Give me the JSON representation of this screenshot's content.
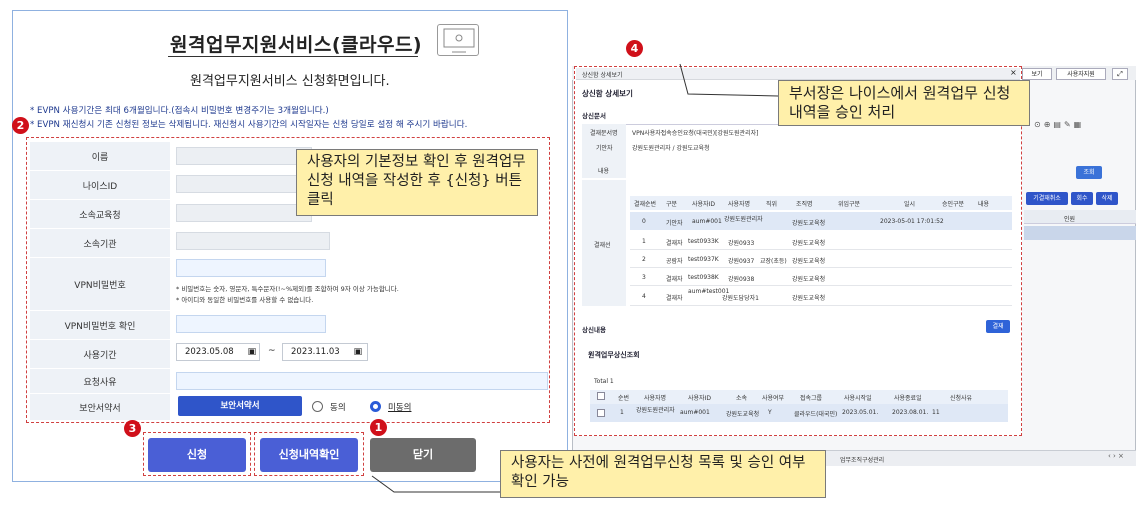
{
  "form": {
    "title": "원격업무지원서비스(클라우드)",
    "subtitle": "원격업무지원서비스 신청화면입니다.",
    "notice1": "* EVPN 사용기간은 최대 6개월입니다.(접속시 비밀번호 변경주기는 3개월입니다.)",
    "notice2": "* EVPN 재신청시 기존 신청된 정보는 삭제됩니다. 재신청시 사용기간의 시작일자는 신청 당일로 설정 해 주시기 바랍니다.",
    "fields": {
      "name_label": "이름",
      "nice_id_label": "나이스ID",
      "office_label": "소속교육청",
      "org_label": "소속기관",
      "vpn_pw_label": "VPN비밀번호",
      "vpn_pw_note1": "* 비밀번호는 숫자, 영문자, 특수문자(!~%제외)를 조합하여 9자 이상 가능합니다.",
      "vpn_pw_note2": "* 아이디와 동일한 비밀번호를 사용할 수 없습니다.",
      "vpn_pw_confirm_label": "VPN비밀번호 확인",
      "period_label": "사용기간",
      "start_date": "2023.05.08",
      "end_date": "2023.11.03",
      "period_sep": "~",
      "reason_label": "요청사유",
      "security_label": "보안서약서",
      "security_button": "보안서약서",
      "agree_label": "동의",
      "disagree_label": "미동의"
    },
    "buttons": {
      "apply": "신청",
      "history": "신청내역확인",
      "close": "닫기"
    }
  },
  "markers": {
    "m1": "1",
    "m2": "2",
    "m3": "3",
    "m4": "4"
  },
  "callouts": {
    "user_info": "사용자의 기본정보 확인 후 원격업무 신청 내역을 작성한 후 {신청} 버튼 클릭",
    "manager": "부서장은 나이스에서 원격업무 신청 내역을 승인 처리",
    "history": "사용자는 사전에 원격업무신청 목록 및 승인 여부 확인 가능"
  },
  "approval": {
    "window_title": "상신함 상세보기",
    "section_title": "상신함 상세보기",
    "doc_section": "상신문서",
    "doc_title_label": "결재문서명",
    "doc_title_value": "VPN사용자접속승인요청(대국민)[강원도원관리자]",
    "drafter_label": "기안자",
    "drafter_value": "강원도원관리자 / 강원도교육청",
    "content_label": "내용",
    "line_label": "결재선",
    "table_headers": [
      "결재순번",
      "구분",
      "사용자ID",
      "사용자명",
      "직위",
      "조직명",
      "위임구분",
      "일시",
      "승인구분",
      "내용"
    ],
    "table_rows": [
      [
        "0",
        "기안자",
        "aum#001",
        "강원도원관리자",
        "",
        "강원도교육청",
        "",
        "2023-05-01 17:01:52",
        "",
        ""
      ],
      [
        "1",
        "결재자",
        "test0933K",
        "강원0933",
        "",
        "강원도교육청",
        "",
        "",
        "",
        ""
      ],
      [
        "2",
        "공람자",
        "test0937K",
        "강원0937",
        "교장(초등)",
        "강원도교육청",
        "",
        "",
        "",
        ""
      ],
      [
        "3",
        "결재자",
        "test0938K",
        "강원0938",
        "",
        "강원도교육청",
        "",
        "",
        "",
        ""
      ],
      [
        "4",
        "결재자",
        "aum#test001",
        "강원도담당자1",
        "",
        "강원도교육청",
        "",
        "",
        "",
        ""
      ]
    ],
    "submit_section": "상신내용",
    "approve_btn": "결재",
    "list_title": "원격업무상신조회",
    "total": "Total 1",
    "list_headers": [
      "순번",
      "사용자명",
      "사용자ID",
      "소속",
      "사용여부",
      "접속그룹",
      "사용시작일",
      "사용종료일",
      "신청사유"
    ],
    "list_row": [
      "1",
      "강원도원관리자",
      "aum#001",
      "강원도교육청",
      "Y",
      "클라우드(대국민)",
      "2023.05.01.",
      "2023.08.01.",
      "11"
    ]
  },
  "host": {
    "btn_view": "보기",
    "btn_remote": "사용자지원",
    "search_btn": "조회",
    "tab_label": "업무조직구성관리",
    "cancel_btn": "기결재취소",
    "count_btn": "회수",
    "delete_btn": "삭제",
    "col_person": "인원"
  },
  "colors": {
    "primary_button": "#4a5fd6",
    "dark_button": "#6c6c6c",
    "callout_bg": "#fff0aa",
    "marker_red": "#d0101a"
  }
}
